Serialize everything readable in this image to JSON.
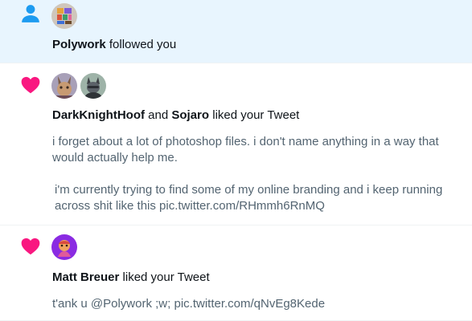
{
  "notifications": [
    {
      "kind": "follow",
      "icon": "person-icon",
      "icon_color": "#1d9bf0",
      "unread_bg": "#e8f5fe",
      "actors": [
        "Polywork"
      ],
      "action": "followed you"
    },
    {
      "kind": "like",
      "icon": "heart-icon",
      "icon_color": "#f91880",
      "actors": [
        "DarkKnightHoof",
        "Sojaro"
      ],
      "conjunction": "and",
      "action": "liked your Tweet",
      "tweet": [
        "i forget about a lot of photoshop files. i don't name anything in a way that would actually help me.",
        "i'm currently trying to find some of my online branding and i keep running across shit like this pic.twitter.com/RHmmh6RnMQ"
      ]
    },
    {
      "kind": "like",
      "icon": "heart-icon",
      "icon_color": "#f91880",
      "actors": [
        "Matt Breuer"
      ],
      "action": "liked your Tweet",
      "tweet": [
        "t'ank u @Polywork ;w; pic.twitter.com/qNvEg8Kede"
      ]
    }
  ]
}
